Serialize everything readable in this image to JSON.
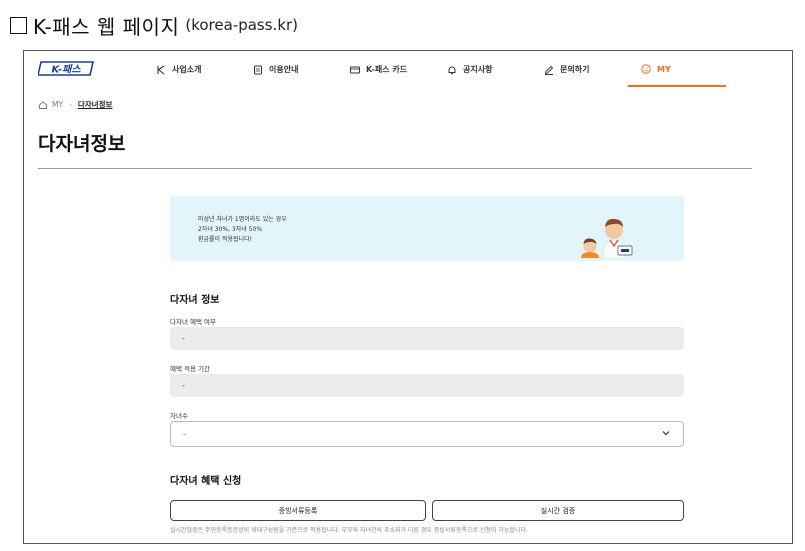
{
  "caption": {
    "main": "K-패스 웹 페이지",
    "sub": "(korea-pass.kr)"
  },
  "logo": {
    "text": "K-패스",
    "icon": "k-pass-logo"
  },
  "nav": {
    "items": [
      {
        "label": "사업소개",
        "icon": "k-symbol-icon"
      },
      {
        "label": "이용안내",
        "icon": "document-icon"
      },
      {
        "label": "K-패스 카드",
        "icon": "card-icon"
      },
      {
        "label": "공지사항",
        "icon": "bell-icon"
      },
      {
        "label": "문의하기",
        "icon": "pencil-icon"
      },
      {
        "label": "MY",
        "icon": "smile-icon",
        "active": true
      }
    ]
  },
  "breadcrumb": {
    "home": "MY",
    "current": "다자녀정보"
  },
  "page_title": "다자녀정보",
  "banner": {
    "lines": [
      "미성년 자녀가 1명이라도 있는 경우",
      "2자녀 30%, 3자녀 50%",
      "환급률이 적용됩니다!"
    ]
  },
  "section_info": {
    "title": "다자녀 정보",
    "fields": [
      {
        "label": "다자녀 혜택 여부",
        "value": "-"
      },
      {
        "label": "혜택 적용 기간",
        "value": "-"
      }
    ],
    "children_label": "자녀수",
    "children_value": "-"
  },
  "section_apply": {
    "title": "다자녀 혜택 신청",
    "btn_doc": "증빙서류등록",
    "btn_verify": "실시간 검증",
    "note": "실시간검증은 주민등록등본상의 세대구성원을 기준으로 적용됩니다. 부모와 자녀간의 주소지가 다른 경우 증빙서류등록으로 신청이 가능합니다."
  },
  "colors": {
    "accent": "#f06e2a",
    "logo_blue": "#1b3f8f",
    "banner_bg": "#e2f5fa"
  }
}
